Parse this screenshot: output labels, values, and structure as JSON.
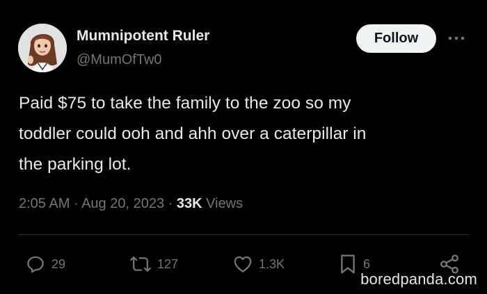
{
  "author": {
    "display_name": "Mumnipotent Ruler",
    "handle": "@MumOfTw0"
  },
  "follow_button": {
    "label": "Follow"
  },
  "more_button": {
    "icon": "more-dots-icon"
  },
  "tweet": {
    "text": "Paid $75 to take the family to the zoo so my\ntoddler could ooh and ahh over a caterpillar in\nthe parking lot."
  },
  "meta": {
    "time": "2:05 AM",
    "separator": "·",
    "date": "Aug 20, 2023",
    "views_count": "33K",
    "views_label": "Views"
  },
  "actions": {
    "replies": {
      "count": "29",
      "icon": "reply-icon"
    },
    "retweets": {
      "count": "127",
      "icon": "retweet-icon"
    },
    "likes": {
      "count": "1.3K",
      "icon": "heart-icon"
    },
    "bookmarks": {
      "count": "6",
      "icon": "bookmark-icon"
    },
    "share": {
      "icon": "share-icon"
    }
  },
  "watermark": {
    "text": "boredpanda.com"
  },
  "colors": {
    "background": "#000000",
    "primary_text": "#e7e9ea",
    "secondary_text": "#71767b",
    "follow_bg": "#eff3f4",
    "divider": "#2f3336"
  }
}
